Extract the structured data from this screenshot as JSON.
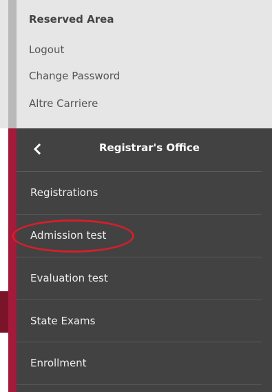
{
  "reserved_area": {
    "title": "Reserved Area",
    "links": [
      {
        "label": "Logout"
      },
      {
        "label": "Change Password"
      },
      {
        "label": "Altre Carriere"
      }
    ]
  },
  "menu": {
    "title": "Registrar's Office",
    "back_icon": "chevron-left-icon",
    "items": [
      {
        "label": "Registrations"
      },
      {
        "label": "Admission test",
        "highlighted": true
      },
      {
        "label": "Evaluation test"
      },
      {
        "label": "State Exams"
      },
      {
        "label": "Enrollment"
      }
    ]
  },
  "colors": {
    "reserved_bg": "#e6e6e6",
    "menu_bg": "#424242",
    "accent": "#a31a3a",
    "highlight": "#d41f2b"
  }
}
